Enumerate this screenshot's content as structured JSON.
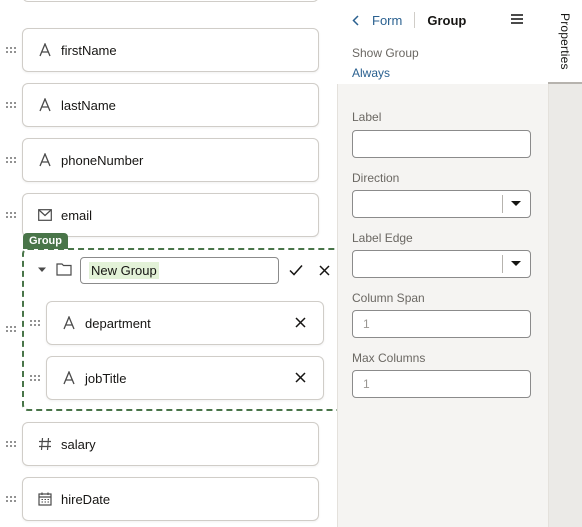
{
  "canvas": {
    "fields": [
      {
        "label": "firstName",
        "icon": "text-icon"
      },
      {
        "label": "lastName",
        "icon": "text-icon"
      },
      {
        "label": "phoneNumber",
        "icon": "text-icon"
      },
      {
        "label": "email",
        "icon": "email-icon"
      }
    ],
    "group": {
      "badge": "Group",
      "name_value": "New Group",
      "fields": [
        {
          "label": "department",
          "icon": "text-icon"
        },
        {
          "label": "jobTitle",
          "icon": "text-icon"
        }
      ]
    },
    "fields_after": [
      {
        "label": "salary",
        "icon": "hash-icon"
      },
      {
        "label": "hireDate",
        "icon": "calendar-icon"
      }
    ]
  },
  "panel": {
    "breadcrumb_link": "Form",
    "breadcrumb_current": "Group",
    "show_group_label": "Show Group",
    "show_group_value": "Always",
    "label_label": "Label",
    "direction_label": "Direction",
    "label_edge_label": "Label Edge",
    "column_span_label": "Column Span",
    "column_span_value": "1",
    "max_columns_label": "Max Columns",
    "max_columns_value": "1"
  },
  "tabs": {
    "properties": "Properties"
  },
  "colors": {
    "group_accent": "#497549",
    "link": "#2b6190",
    "panel_bg": "#f5f4f2"
  }
}
